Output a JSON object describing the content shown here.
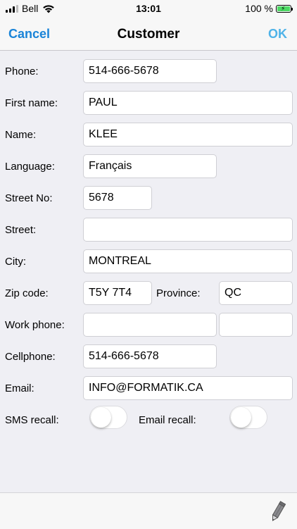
{
  "status_bar": {
    "carrier": "Bell",
    "time": "13:01",
    "battery": "100 %",
    "battery_level": 1.0,
    "icons": [
      "signal-icon",
      "wifi-icon",
      "battery-icon"
    ]
  },
  "nav": {
    "cancel_label": "Cancel",
    "title": "Customer",
    "ok_label": "OK"
  },
  "form": {
    "phone_label": "Phone:",
    "phone_value": "514-666-5678",
    "first_name_label": "First name:",
    "first_name_value": "PAUL",
    "name_label": "Name:",
    "name_value": "KLEE",
    "language_label": "Language:",
    "language_value": "Français",
    "street_no_label": "Street No:",
    "street_no_value": "5678",
    "street_label": "Street:",
    "street_value": "",
    "city_label": "City:",
    "city_value": "MONTREAL",
    "zip_label": "Zip code:",
    "zip_value": "T5Y 7T4",
    "province_label": "Province:",
    "province_value": "QC",
    "work_phone_label": "Work phone:",
    "work_phone_value": "",
    "work_phone_ext_value": "",
    "cellphone_label": "Cellphone:",
    "cellphone_value": "514-666-5678",
    "email_label": "Email:",
    "email_value": "INFO@FORMATIK.CA",
    "sms_recall_label": "SMS recall:",
    "sms_recall_on": false,
    "email_recall_label": "Email recall:",
    "email_recall_on": false
  },
  "toolbar": {
    "icon": "pencil-icon"
  },
  "colors": {
    "accent_cancel": "#1a84d8",
    "accent_ok": "#4fb3e8",
    "battery": "#4cd964",
    "background": "#efeff4"
  }
}
